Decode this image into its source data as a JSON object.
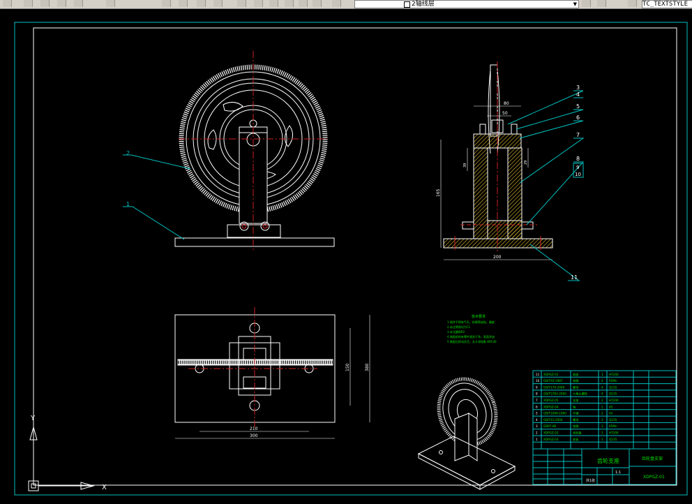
{
  "toolbar": {
    "layer_label": "2轴线层",
    "text_style_value": "TC_TEXTSTYLE",
    "icons": [
      "layers-icon",
      "zoom-realtime-icon",
      "zoom-window-icon",
      "zoom-previous-icon",
      "pan-icon",
      "properties-icon",
      "design-center-icon",
      "tool-palette-icon",
      "table-icon",
      "help-icon"
    ]
  },
  "drawing": {
    "balloons": {
      "b1": "1",
      "b2": "2",
      "b3": "3",
      "b4": "4",
      "b5": "5",
      "b6": "6",
      "b7": "7",
      "b8": "8",
      "b9": "9",
      "b10": "10",
      "b11": "11"
    },
    "dims": {
      "w80": "80",
      "w50": "50",
      "h165": "165",
      "h200": "200",
      "h39": "39",
      "h29": "29",
      "w290": "290",
      "w210": "210",
      "w300": "300",
      "v150": "150",
      "v380": "380"
    },
    "notes": {
      "title": "技术要求",
      "line1": "1.铸件不得有气孔、砂眼等缺陷，硬度",
      "line2": "2.未注倒角均为C1",
      "line3": "3.未注圆角R2",
      "line4": "4.装配前所有零件清洗干净，表面涂油",
      "line5": "5.装配后转动灵活，无卡滞现象 HRC40"
    },
    "bom": {
      "rows": [
        {
          "no": "11",
          "code": "XDPGZ-01",
          "name": "底座",
          "qty": "1",
          "mat": "HT200"
        },
        {
          "no": "10",
          "code": "GB/T93-1987",
          "name": "垫圈",
          "qty": "4",
          "mat": "65Mn"
        },
        {
          "no": "9",
          "code": "GB/T170-2000",
          "name": "螺母",
          "qty": "4",
          "mat": "Q235"
        },
        {
          "no": "8",
          "code": "GB/T5783-2000",
          "name": "六角头螺栓",
          "qty": "4",
          "mat": "Q235"
        },
        {
          "no": "7",
          "code": "XDPGZ-05",
          "name": "支架",
          "qty": "2",
          "mat": "HT200"
        },
        {
          "no": "6",
          "code": "XDPGZ-04",
          "name": "轴",
          "qty": "1",
          "mat": "45"
        },
        {
          "no": "5",
          "code": "GB/T1096-1990",
          "name": "平键",
          "qty": "2",
          "mat": "45"
        },
        {
          "no": "4",
          "code": "GB/T41-2000",
          "name": "螺母",
          "qty": "3",
          "mat": "Q235"
        },
        {
          "no": "3",
          "code": "GB97-86",
          "name": "垫圈",
          "qty": "3",
          "mat": "65Mn"
        },
        {
          "no": "2",
          "code": "XDPGZ-02",
          "name": "齿轮盘",
          "qty": "1",
          "mat": "HT200"
        },
        {
          "no": "1",
          "code": "XDPGZ-03",
          "name": "底板",
          "qty": "1",
          "mat": "Q235"
        }
      ],
      "header": {
        "no": "序号",
        "code": "代号",
        "name": "名称",
        "qty": "数量",
        "mat": "材料"
      }
    },
    "titleblock": {
      "title": "齿轮支座",
      "drawing_no": "XDPGZ-01",
      "name": "齿轮盘支架",
      "scale": "1:1",
      "sheet": "共1张"
    }
  }
}
